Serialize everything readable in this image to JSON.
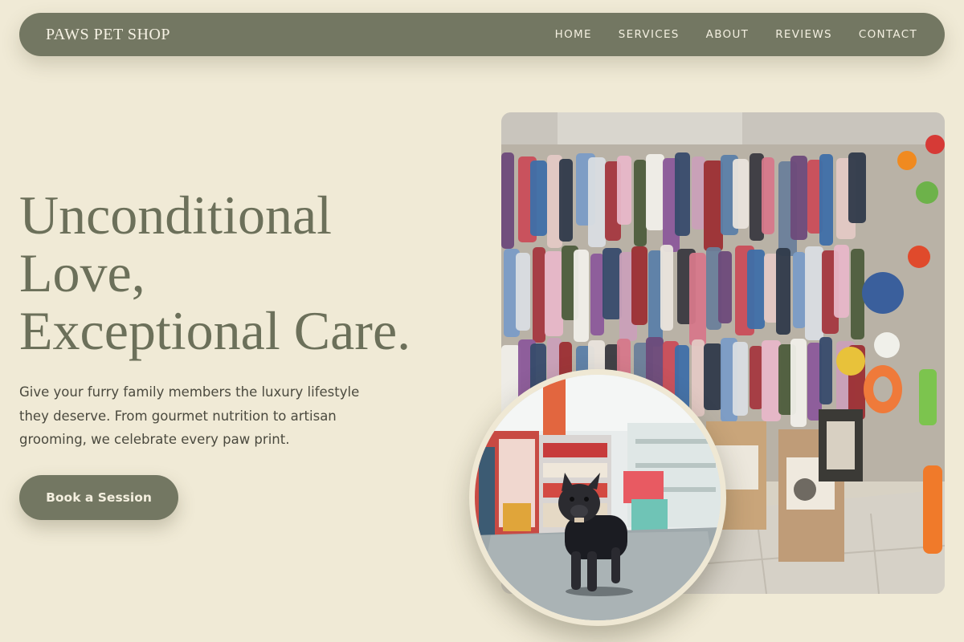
{
  "nav": {
    "brand": "PAWS PET SHOP",
    "links": [
      "HOME",
      "SERVICES",
      "ABOUT",
      "REVIEWS",
      "CONTACT"
    ]
  },
  "hero": {
    "title_lines": [
      "Unconditional",
      "Love,",
      "Exceptional Care."
    ],
    "description": "Give your furry family members the luxury lifestyle they deserve. From gourmet nutrition to artisan grooming, we celebrate every paw print.",
    "cta_label": "Book a Session"
  },
  "images": {
    "main_photo": "pet-shop-clothing-wall-photo",
    "circle_photo": "french-bulldog-in-store-photo"
  },
  "colors": {
    "background": "#f0ead6",
    "primary": "#737762",
    "title_text": "#6c705a",
    "body_text": "#4b4a3f"
  }
}
